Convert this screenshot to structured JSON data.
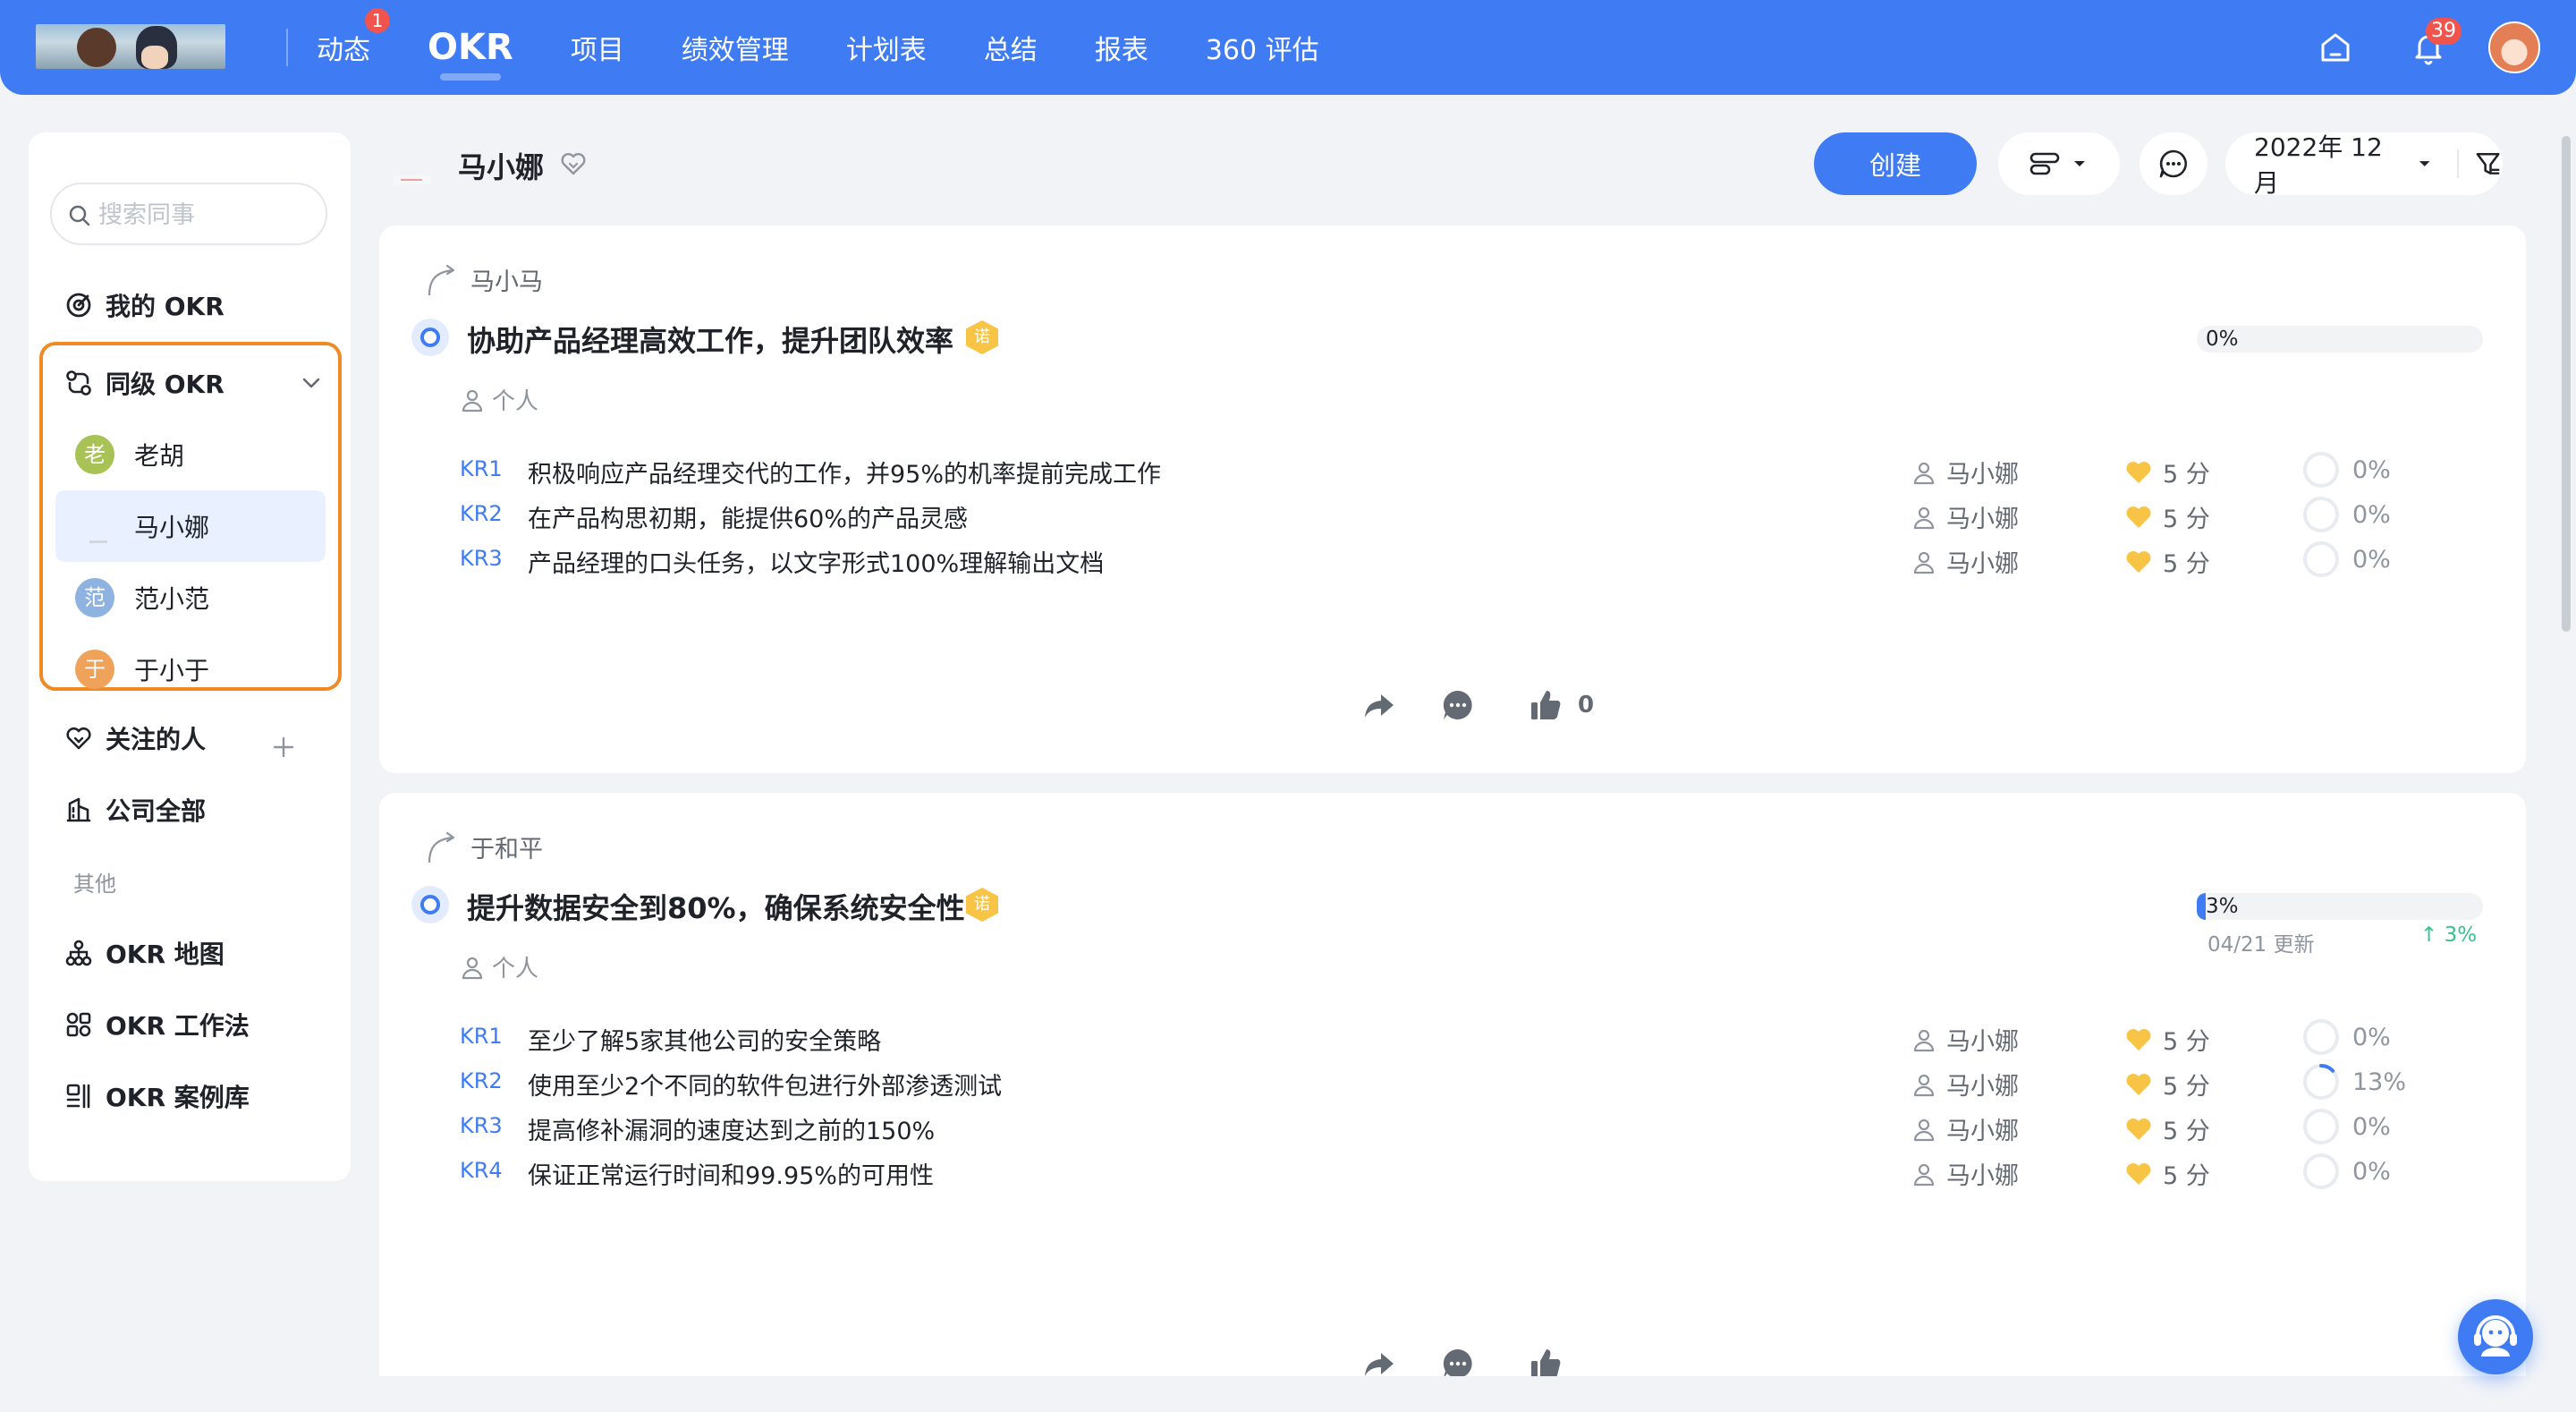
{
  "topnav": {
    "items": [
      {
        "label": "动态",
        "badge": "1"
      },
      {
        "label": "OKR",
        "active": true
      },
      {
        "label": "项目"
      },
      {
        "label": "绩效管理"
      },
      {
        "label": "计划表"
      },
      {
        "label": "总结"
      },
      {
        "label": "报表"
      },
      {
        "label": "360 评估"
      }
    ],
    "notification_count": "39",
    "icons": [
      "home-icon",
      "bell-icon",
      "user-avatar"
    ]
  },
  "sidebar": {
    "search_placeholder": "搜索同事",
    "my_okr": "我的 OKR",
    "peer_okr": "同级 OKR",
    "members": [
      {
        "initial": "老",
        "name": "老胡",
        "color": "#a8c256"
      },
      {
        "initial": "",
        "name": "马小娜",
        "selected": true
      },
      {
        "initial": "范",
        "name": "范小范",
        "color": "#8fb3e0"
      },
      {
        "initial": "于",
        "name": "于小于",
        "color": "#efa35a"
      }
    ],
    "following": "关注的人",
    "company_all": "公司全部",
    "other_section": "其他",
    "tools": [
      "OKR 地图",
      "OKR 工作法",
      "OKR 案例库"
    ]
  },
  "header": {
    "name": "马小娜",
    "create_label": "创建",
    "date_label": "2022年 12月"
  },
  "objectives": [
    {
      "parent": "马小马",
      "title": "协助产品经理高效工作，提升团队效率",
      "badge": "诺",
      "progress": 0,
      "progress_label": "0%",
      "updated": "",
      "delta": "",
      "type": "个人",
      "krs": [
        {
          "no": "KR1",
          "text": "积极响应产品经理交代的工作，并95%的机率提前完成工作",
          "owner": "马小娜",
          "score": "5 分",
          "progress": 0,
          "progress_label": "0%"
        },
        {
          "no": "KR2",
          "text": "在产品构思初期，能提供60%的产品灵感",
          "owner": "马小娜",
          "score": "5 分",
          "progress": 0,
          "progress_label": "0%"
        },
        {
          "no": "KR3",
          "text": "产品经理的口头任务，以文字形式100%理解输出文档",
          "owner": "马小娜",
          "score": "5 分",
          "progress": 0,
          "progress_label": "0%"
        }
      ],
      "likes": "0"
    },
    {
      "parent": "于和平",
      "title": "提升数据安全到80%，确保系统安全性",
      "badge": "诺",
      "progress": 3,
      "progress_label": "3%",
      "updated": "04/21 更新",
      "delta": "↑ 3%",
      "type": "个人",
      "krs": [
        {
          "no": "KR1",
          "text": "至少了解5家其他公司的安全策略",
          "owner": "马小娜",
          "score": "5 分",
          "progress": 0,
          "progress_label": "0%"
        },
        {
          "no": "KR2",
          "text": "使用至少2个不同的软件包进行外部渗透测试",
          "owner": "马小娜",
          "score": "5 分",
          "progress": 13,
          "progress_label": "13%"
        },
        {
          "no": "KR3",
          "text": "提高修补漏洞的速度达到之前的150%",
          "owner": "马小娜",
          "score": "5 分",
          "progress": 0,
          "progress_label": "0%"
        },
        {
          "no": "KR4",
          "text": "保证正常运行时间和99.95%的可用性",
          "owner": "马小娜",
          "score": "5 分",
          "progress": 0,
          "progress_label": "0%"
        }
      ],
      "likes": ""
    }
  ],
  "colors": {
    "primary": "#3f7cf4",
    "highlight_border": "#f08a24",
    "success": "#34c38f",
    "badge_red": "#f0544c"
  }
}
